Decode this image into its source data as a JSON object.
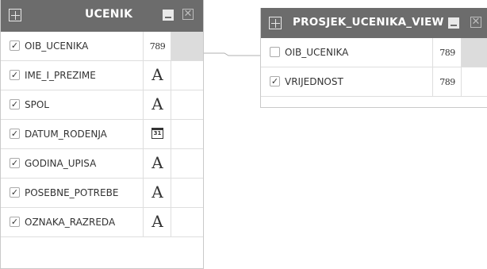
{
  "tables": [
    {
      "title": "UCENIK",
      "columns": [
        {
          "name": "OIB_UCENIKA",
          "checked": true,
          "type_label": "789",
          "type_icon": "number-type-icon",
          "extra_shaded": true
        },
        {
          "name": "IME_I_PREZIME",
          "checked": true,
          "type_label": "A",
          "type_icon": "text-type-icon",
          "extra_shaded": false
        },
        {
          "name": "SPOL",
          "checked": true,
          "type_label": "A",
          "type_icon": "text-type-icon",
          "extra_shaded": false
        },
        {
          "name": "DATUM_RODENJA",
          "checked": true,
          "type_label": "31",
          "type_icon": "calendar-type-icon",
          "extra_shaded": false
        },
        {
          "name": "GODINA_UPISA",
          "checked": true,
          "type_label": "A",
          "type_icon": "text-type-icon",
          "extra_shaded": false
        },
        {
          "name": "POSEBNE_POTREBE",
          "checked": true,
          "type_label": "A",
          "type_icon": "text-type-icon",
          "extra_shaded": false
        },
        {
          "name": "OZNAKA_RAZREDA",
          "checked": true,
          "type_label": "A",
          "type_icon": "text-type-icon",
          "extra_shaded": false
        }
      ]
    },
    {
      "title": "PROSJEK_UCENIKA_VIEW",
      "columns": [
        {
          "name": "OIB_UCENIKA",
          "checked": false,
          "type_label": "789",
          "type_icon": "number-type-icon",
          "extra_shaded": true
        },
        {
          "name": "VRIJEDNOST",
          "checked": true,
          "type_label": "789",
          "type_icon": "number-type-icon",
          "extra_shaded": false
        }
      ]
    }
  ],
  "join": {
    "from": "UCENIK.OIB_UCENIKA",
    "to": "PROSJEK_UCENIKA_VIEW.OIB_UCENIKA"
  },
  "colors": {
    "header_bg": "#6c6c6c",
    "header_text": "#ffffff",
    "shaded_cell": "#dcdcdc",
    "border": "#dedede"
  }
}
